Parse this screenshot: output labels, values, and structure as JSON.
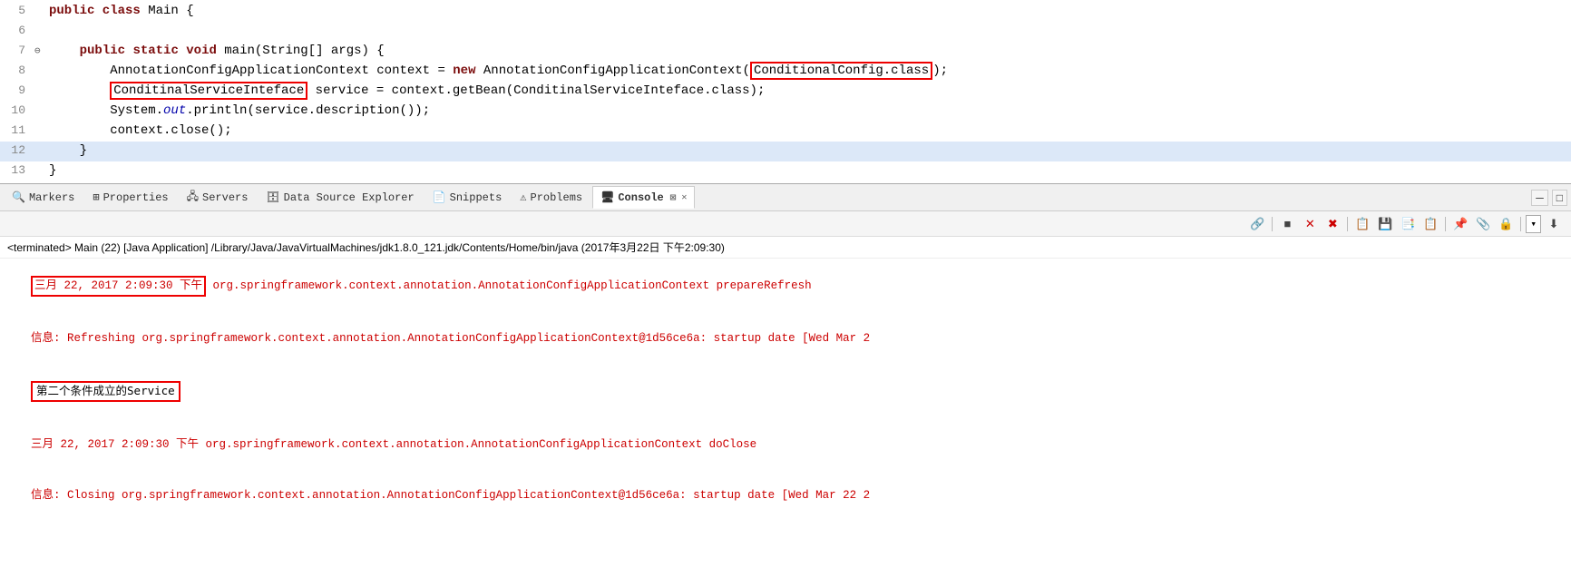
{
  "editor": {
    "lines": [
      {
        "num": "5",
        "arrow": "",
        "content": "public class Main {",
        "highlight": false
      },
      {
        "num": "6",
        "arrow": "",
        "content": "",
        "highlight": false
      },
      {
        "num": "7",
        "arrow": "⊖",
        "content": "    public static void main(String[] args) {",
        "highlight": false
      },
      {
        "num": "8",
        "arrow": "",
        "content": "        AnnotationConfigApplicationContext context = new AnnotationConfigApplicationContext(",
        "highlight": false,
        "special": "line8"
      },
      {
        "num": "9",
        "arrow": "",
        "content": " service = context.getBean(ConditinalServiceInteface.class);",
        "highlight": false,
        "special": "line9"
      },
      {
        "num": "10",
        "arrow": "",
        "content": "        System.out.println(service.description());",
        "highlight": false
      },
      {
        "num": "11",
        "arrow": "",
        "content": "        context.close();",
        "highlight": false
      },
      {
        "num": "12",
        "arrow": "",
        "content": "    }",
        "highlight": true
      },
      {
        "num": "13",
        "arrow": "",
        "content": "}",
        "highlight": false
      }
    ]
  },
  "tabs": {
    "items": [
      {
        "label": "Markers",
        "icon": "🔍",
        "active": false
      },
      {
        "label": "Properties",
        "icon": "⊞",
        "active": false
      },
      {
        "label": "Servers",
        "icon": "🖧",
        "active": false
      },
      {
        "label": "Data Source Explorer",
        "icon": "🗄",
        "active": false
      },
      {
        "label": "Snippets",
        "icon": "📄",
        "active": false
      },
      {
        "label": "Problems",
        "icon": "⚠",
        "active": false
      },
      {
        "label": "Console",
        "icon": "🖥",
        "active": true
      }
    ],
    "close_label": "✕",
    "minimize_label": "─",
    "maximize_label": "□"
  },
  "toolbar": {
    "buttons": [
      "🔗",
      "■",
      "✕",
      "✖",
      "📋",
      "💾",
      "📑",
      "📋",
      "📌",
      "📎",
      "🔒",
      "➡",
      "⬇"
    ]
  },
  "console": {
    "status_line": "<terminated> Main (22) [Java Application] /Library/Java/JavaVirtualMachines/jdk1.8.0_121.jdk/Contents/Home/bin/java (2017年3月22日 下午2:09:30)",
    "output_lines": [
      {
        "text": "三月 22, 2017 2:09:30 下午 org.springframework.context.annotation.AnnotationConfigApplicationContext prepareRefresh",
        "color": "red"
      },
      {
        "text": "信息: Refreshing org.springframework.context.annotation.AnnotationConfigApplicationContext@1d56ce6a: startup date [Wed Mar 2",
        "color": "red"
      },
      {
        "text": "第二个条件成立的Service",
        "color": "black",
        "boxed": true
      },
      {
        "text": "三月 22, 2017 2:09:30 下午 org.springframework.context.annotation.AnnotationConfigApplicationContext doClose",
        "color": "red"
      },
      {
        "text": "信息: Closing org.springframework.context.annotation.AnnotationConfigApplicationContext@1d56ce6a: startup date [Wed Mar 22 2",
        "color": "red"
      }
    ]
  }
}
